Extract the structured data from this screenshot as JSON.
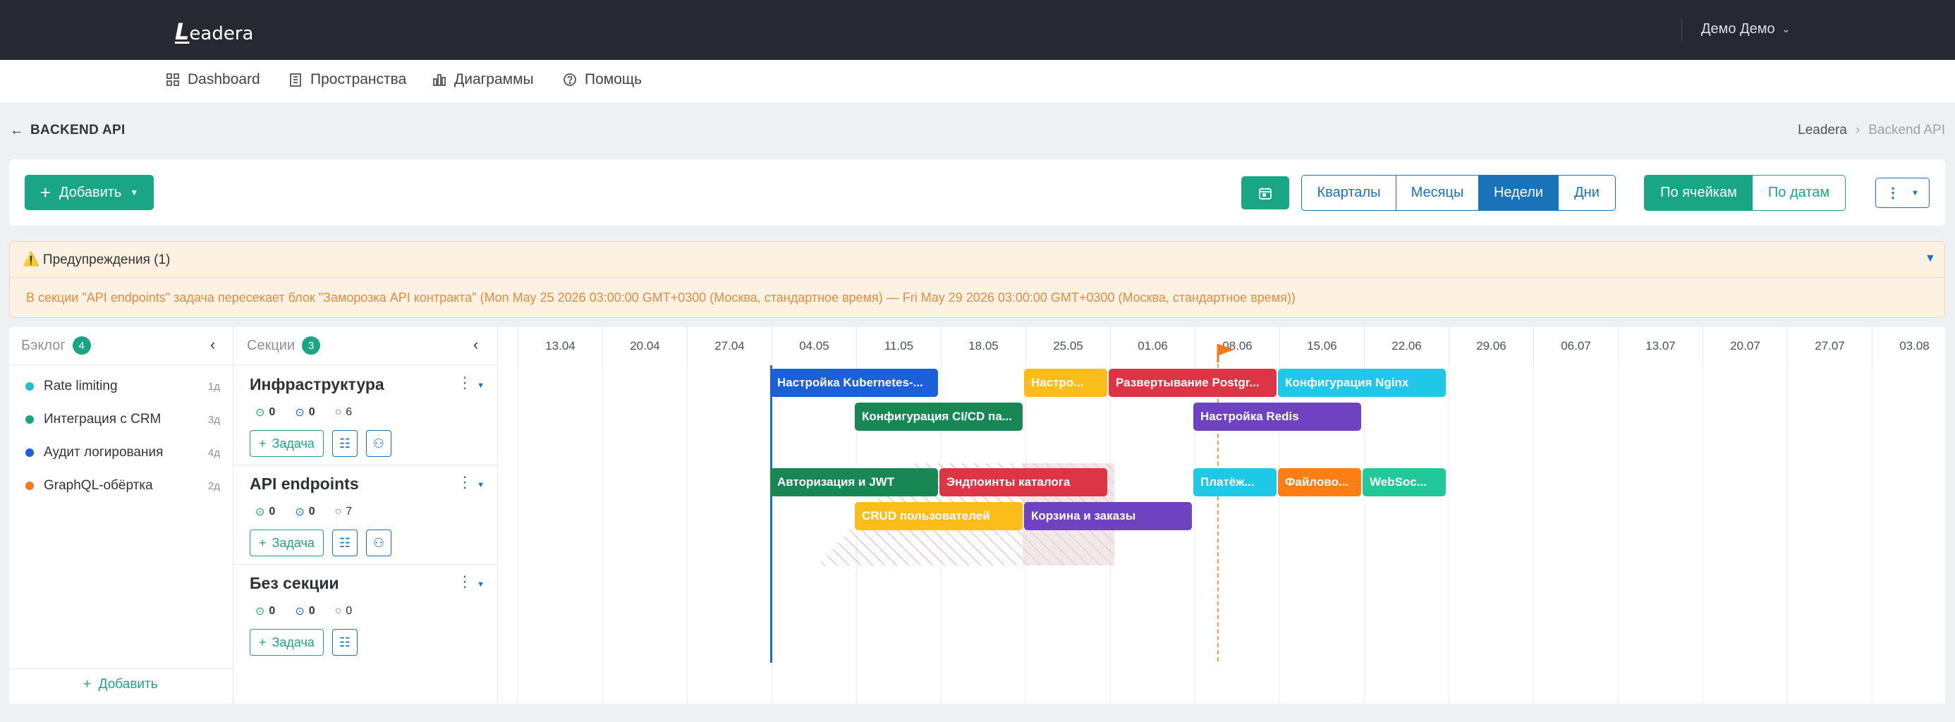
{
  "app": {
    "logo_letter": "L",
    "logo_rest": "eadera",
    "user": "Демо Демо"
  },
  "nav": {
    "items": [
      {
        "label": "Dashboard",
        "icon": "grid-icon"
      },
      {
        "label": "Пространства",
        "icon": "building-icon"
      },
      {
        "label": "Диаграммы",
        "icon": "chart-icon"
      },
      {
        "label": "Помощь",
        "icon": "help-icon"
      }
    ]
  },
  "page": {
    "title": "BACKEND API",
    "breadcrumb": [
      "Leadera",
      "Backend API"
    ]
  },
  "toolbar": {
    "add_label": "Добавить",
    "scale_options": [
      "Кварталы",
      "Месяцы",
      "Недели",
      "Дни"
    ],
    "scale_selected": "Недели",
    "mode_options": [
      "По ячейкам",
      "По датам"
    ],
    "mode_selected": "По ячейкам"
  },
  "warnings": {
    "title": "⚠️ Предупреждения (1)",
    "message": "В секции \"API endpoints\" задача пересекает блок \"Заморозка API контракта\" (Mon May 25 2026 03:00:00 GMT+0300 (Москва, стандартное время) — Fri May 29 2026 03:00:00 GMT+0300 (Москва, стандартное время))"
  },
  "backlog": {
    "title": "Бэклог",
    "count": "4",
    "add_label": "Добавить",
    "items": [
      {
        "label": "Rate limiting",
        "dur": "1д",
        "color": "#1fbfd6"
      },
      {
        "label": "Интеграция с CRM",
        "dur": "3д",
        "color": "#1aa584"
      },
      {
        "label": "Аудит логирования",
        "dur": "4д",
        "color": "#1b5fd9"
      },
      {
        "label": "GraphQL-обёртка",
        "dur": "2д",
        "color": "#f5781f"
      }
    ]
  },
  "sections_panel": {
    "title": "Секции",
    "count": "3",
    "task_label": "Задача",
    "sections": [
      {
        "name": "Инфраструктура",
        "done": "0",
        "progress": "0",
        "todo": "6"
      },
      {
        "name": "API endpoints",
        "done": "0",
        "progress": "0",
        "todo": "7"
      },
      {
        "name": "Без секции",
        "done": "0",
        "progress": "0",
        "todo": "0"
      }
    ]
  },
  "timeline": {
    "weeks": [
      "13.04",
      "20.04",
      "27.04",
      "04.05",
      "11.05",
      "18.05",
      "25.05",
      "01.06",
      "08.06",
      "15.06",
      "22.06",
      "29.06",
      "06.07",
      "13.07",
      "20.07",
      "27.07",
      "03.08"
    ],
    "tasks": [
      {
        "label": "Настройка Kubernetes-...",
        "color": "#1b5fd9",
        "section": 0,
        "row": 0,
        "start": 3,
        "span": 2
      },
      {
        "label": "Настро...",
        "color": "#fbbd1a",
        "section": 0,
        "row": 0,
        "start": 6,
        "span": 1
      },
      {
        "label": "Развертывание Postgr...",
        "color": "#dc3545",
        "section": 0,
        "row": 0,
        "start": 7,
        "span": 2
      },
      {
        "label": "Конфигурация Nginx",
        "color": "#1fc8e6",
        "section": 0,
        "row": 0,
        "start": 9,
        "span": 2
      },
      {
        "label": "Конфигурация CI/CD па...",
        "color": "#198754",
        "section": 0,
        "row": 1,
        "start": 4,
        "span": 2
      },
      {
        "label": "Настройка Redis",
        "color": "#6f42c1",
        "section": 0,
        "row": 1,
        "start": 8,
        "span": 2
      },
      {
        "label": "Авторизация и JWT",
        "color": "#198754",
        "section": 1,
        "row": 0,
        "start": 3,
        "span": 2
      },
      {
        "label": "Эндпоинты каталога",
        "color": "#dc3545",
        "section": 1,
        "row": 0,
        "start": 5,
        "span": 2
      },
      {
        "label": "Платёж...",
        "color": "#1fc8e6",
        "section": 1,
        "row": 0,
        "start": 8,
        "span": 1
      },
      {
        "label": "Файлово...",
        "color": "#fd7e14",
        "section": 1,
        "row": 0,
        "start": 9,
        "span": 1
      },
      {
        "label": "WebSoc...",
        "color": "#20c997",
        "section": 1,
        "row": 0,
        "start": 10,
        "span": 1
      },
      {
        "label": "CRUD пользователей",
        "color": "#fbbd1a",
        "section": 1,
        "row": 1,
        "start": 4,
        "span": 2
      },
      {
        "label": "Корзина и заказы",
        "color": "#6f42c1",
        "section": 1,
        "row": 1,
        "start": 6,
        "span": 2
      }
    ]
  }
}
